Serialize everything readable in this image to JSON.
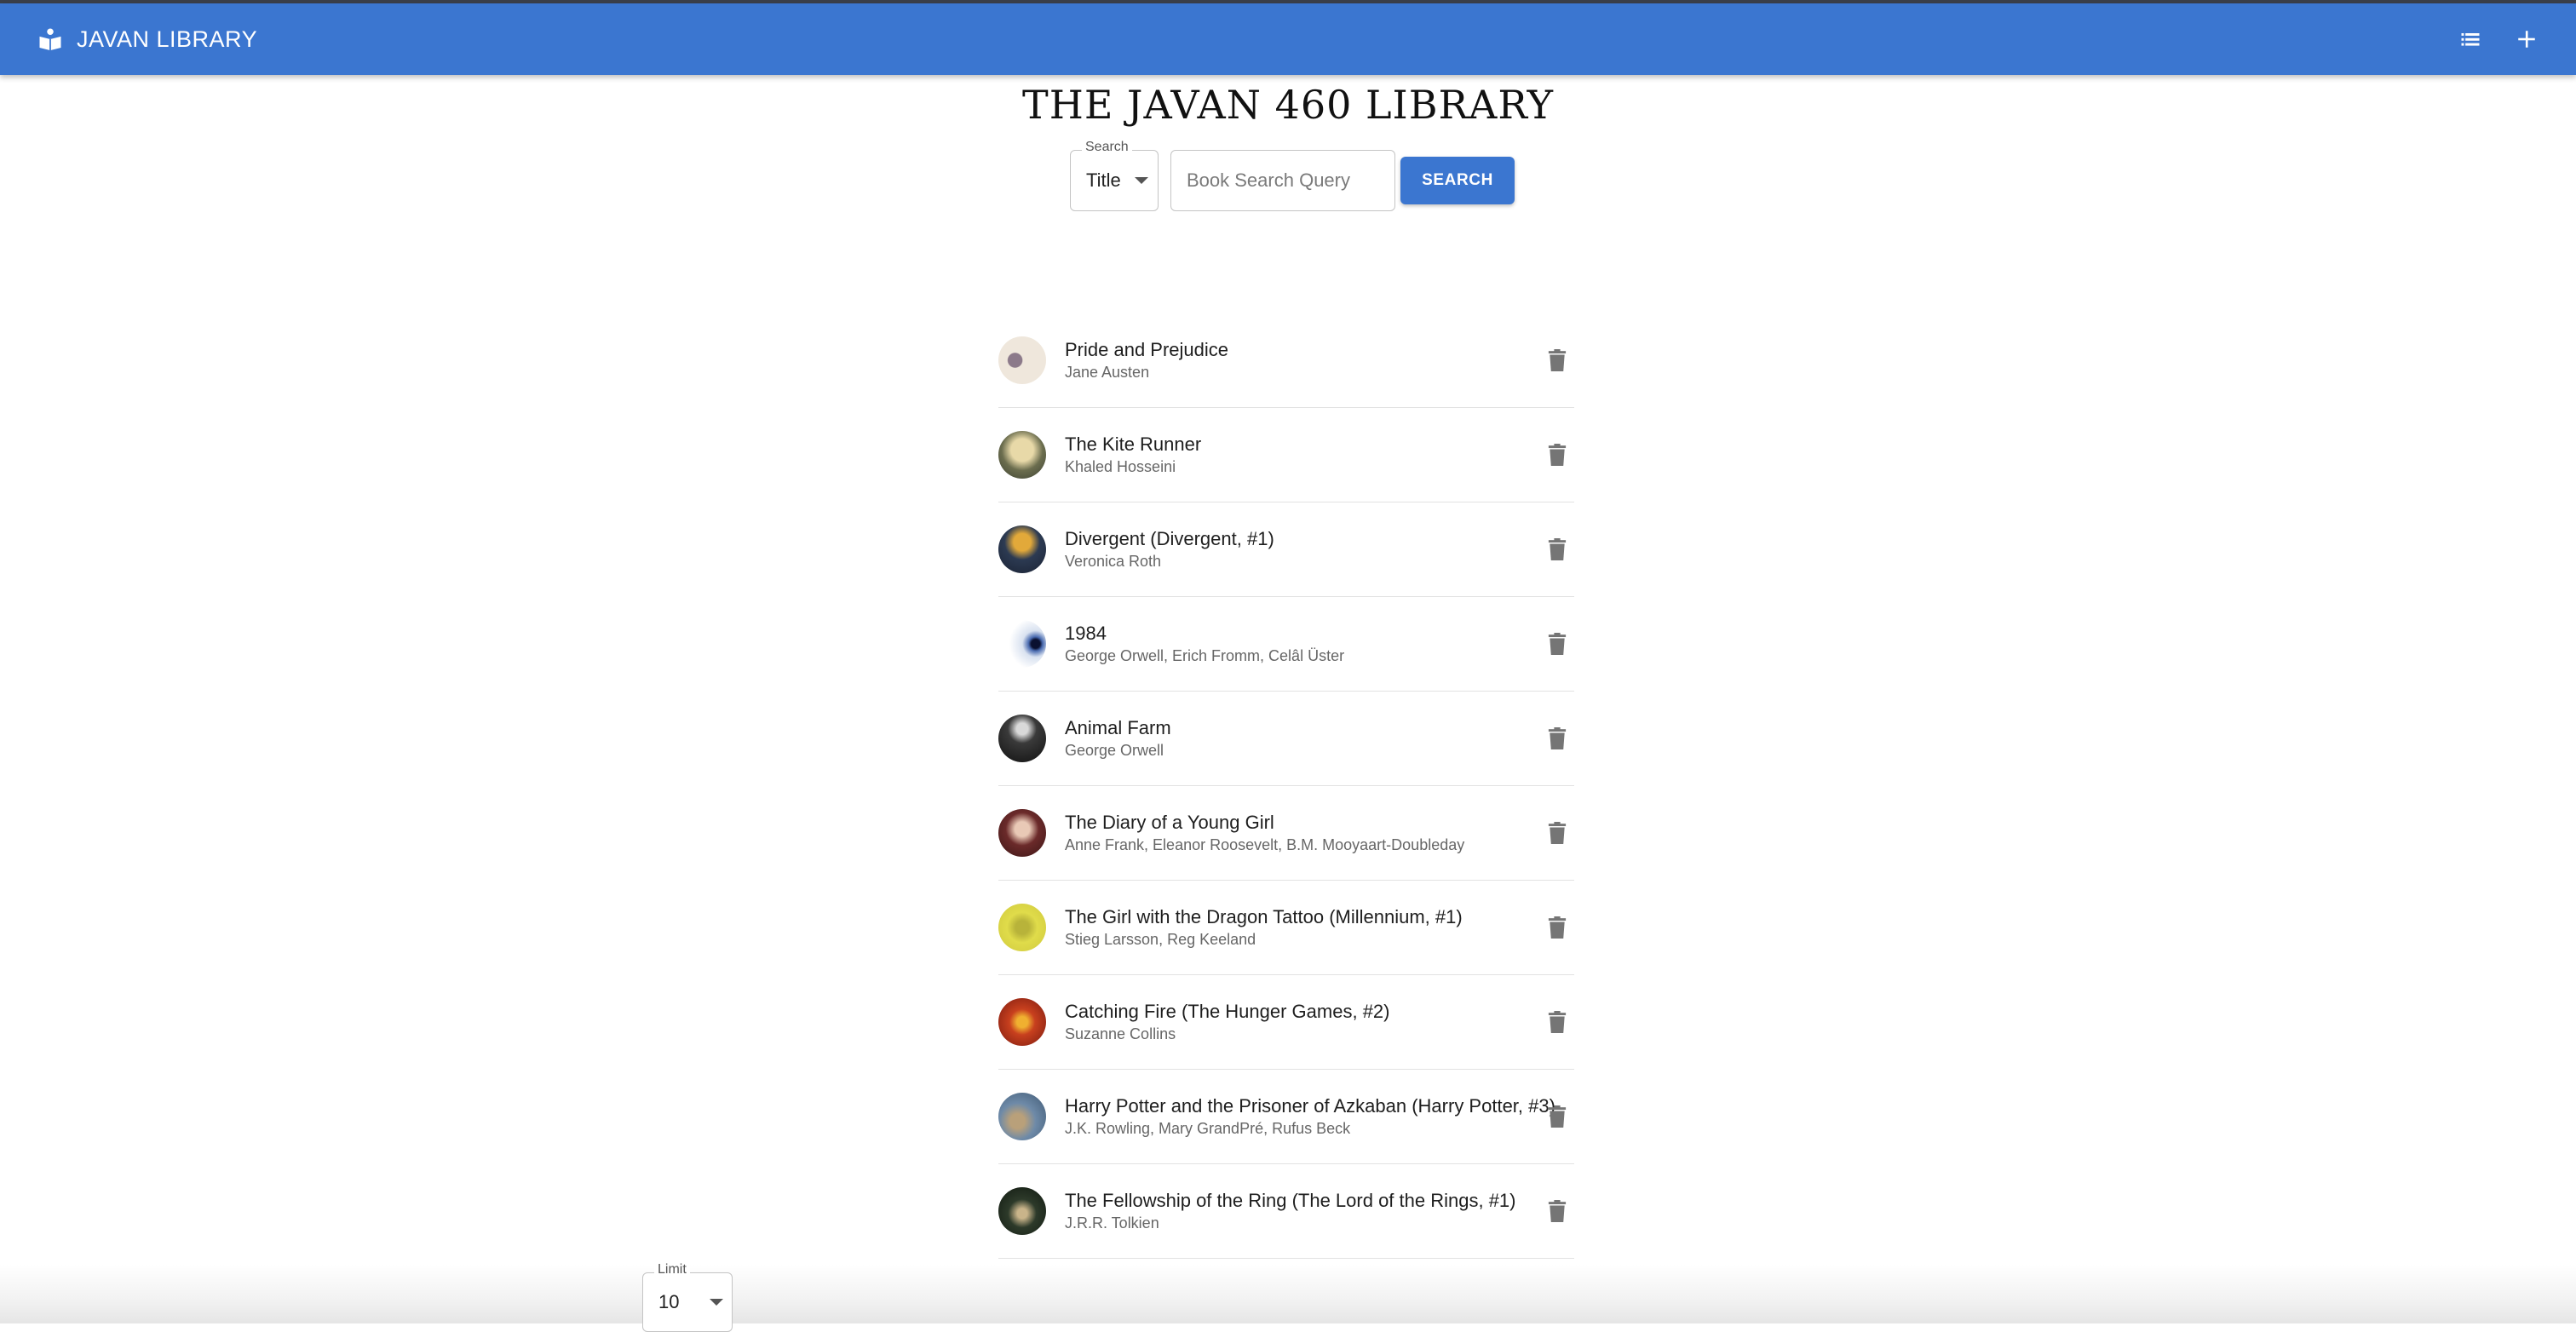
{
  "appbar": {
    "title": "JAVAN LIBRARY",
    "color": "#3b76d0",
    "icons": [
      "book-reader-icon",
      "list-icon",
      "plus-icon"
    ]
  },
  "page": {
    "title": "THE JAVAN 460 LIBRARY"
  },
  "search": {
    "field_label": "Search",
    "field_value": "Title",
    "placeholder": "Book Search Query",
    "button_label": "SEARCH"
  },
  "books": [
    {
      "title": "Pride and Prejudice",
      "author": "Jane Austen"
    },
    {
      "title": "The Kite Runner",
      "author": "Khaled Hosseini"
    },
    {
      "title": "Divergent (Divergent, #1)",
      "author": "Veronica Roth"
    },
    {
      "title": "1984",
      "author": "George Orwell, Erich Fromm, Celâl Üster"
    },
    {
      "title": "Animal Farm",
      "author": "George Orwell"
    },
    {
      "title": "The Diary of a Young Girl",
      "author": "Anne Frank, Eleanor Roosevelt, B.M. Mooyaart-Doubleday"
    },
    {
      "title": "The Girl with the Dragon Tattoo (Millennium, #1)",
      "author": "Stieg Larsson, Reg Keeland"
    },
    {
      "title": "Catching Fire (The Hunger Games, #2)",
      "author": "Suzanne Collins"
    },
    {
      "title": "Harry Potter and the Prisoner of Azkaban (Harry Potter, #3)",
      "author": "J.K. Rowling, Mary GrandPré, Rufus Beck"
    },
    {
      "title": "The Fellowship of the Ring (The Lord of the Rings, #1)",
      "author": "J.R.R. Tolkien"
    }
  ],
  "pagination": {
    "limit_label": "Limit",
    "limit_value": "10"
  }
}
